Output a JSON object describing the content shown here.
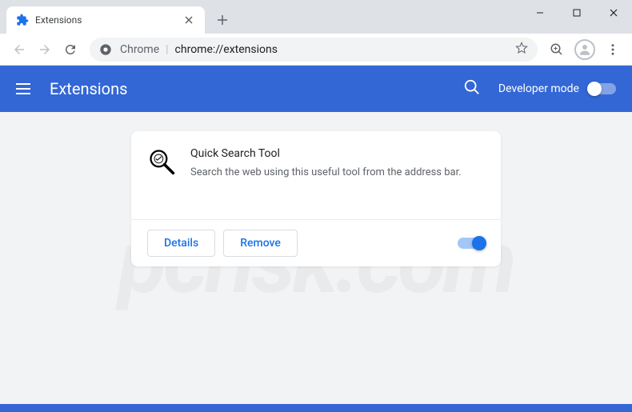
{
  "window": {
    "tab": {
      "title": "Extensions"
    }
  },
  "omnibox": {
    "prefix": "Chrome",
    "url": "chrome://extensions"
  },
  "header": {
    "title": "Extensions",
    "dev_mode_label": "Developer mode",
    "dev_mode_on": false
  },
  "extension": {
    "name": "Quick Search Tool",
    "description": "Search the web using this useful tool from the address bar.",
    "enabled": true,
    "details_label": "Details",
    "remove_label": "Remove"
  },
  "watermark": "pcrisk.com"
}
